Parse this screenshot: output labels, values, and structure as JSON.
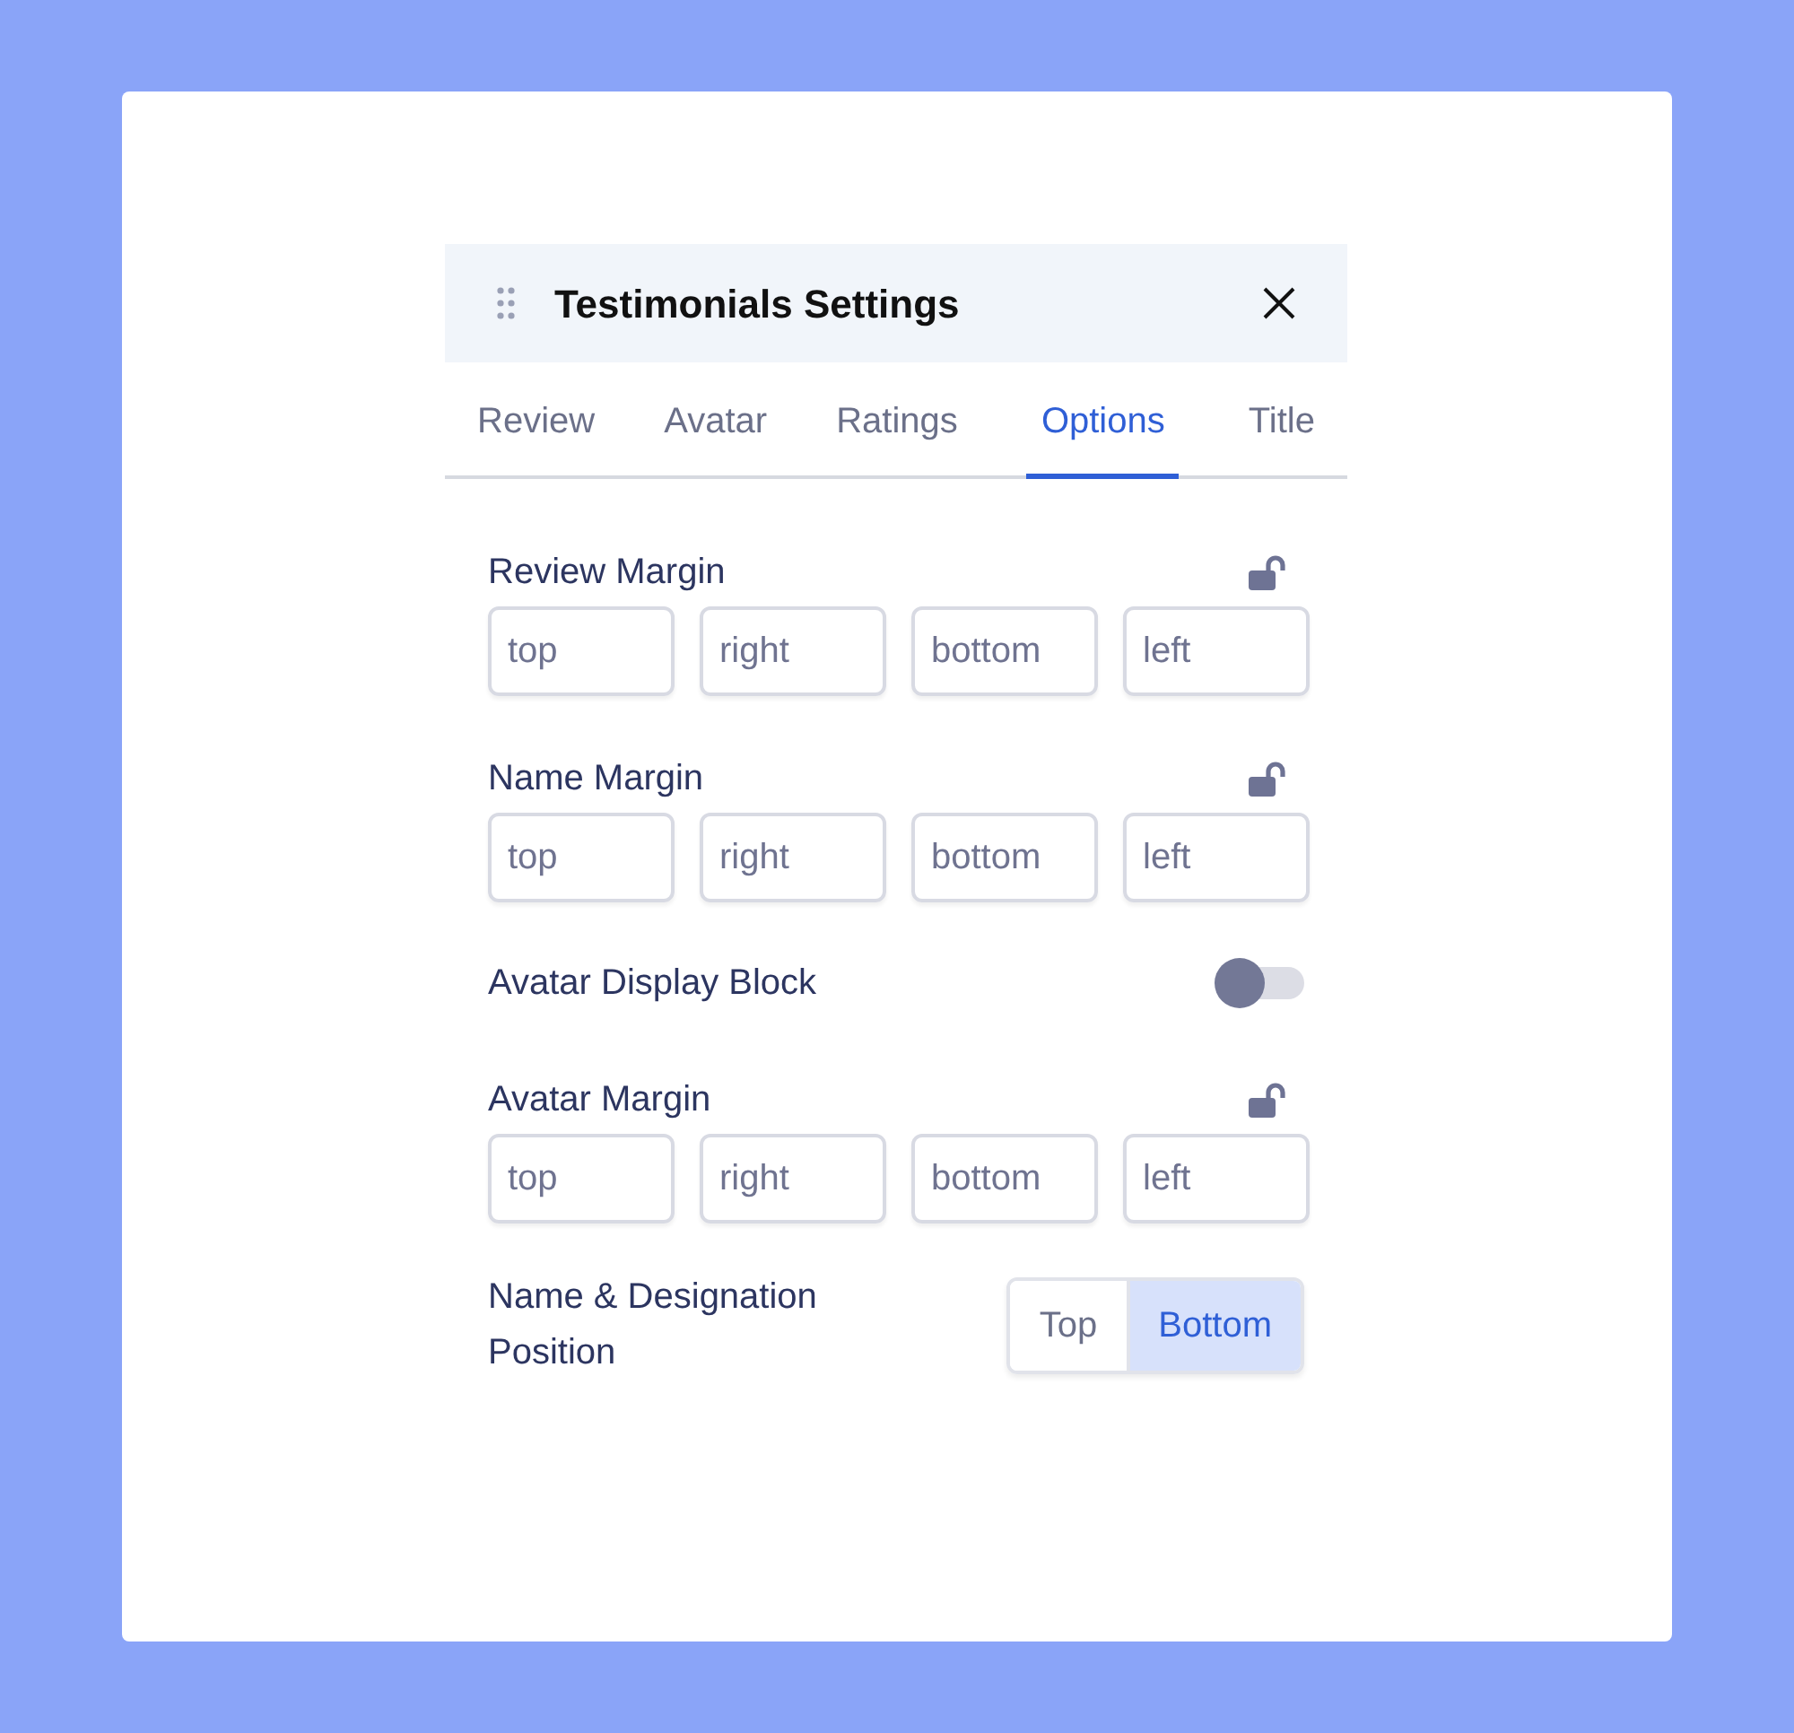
{
  "panel": {
    "title": "Testimonials Settings"
  },
  "tabs": [
    {
      "label": "Review",
      "selected": false
    },
    {
      "label": "Avatar",
      "selected": false
    },
    {
      "label": "Ratings",
      "selected": false
    },
    {
      "label": "Options",
      "selected": true
    },
    {
      "label": "Title",
      "selected": false
    }
  ],
  "settings": [
    {
      "kind": "margin",
      "label": "Review Margin",
      "locked": false,
      "fields": [
        {
          "placeholder": "top"
        },
        {
          "placeholder": "right"
        },
        {
          "placeholder": "bottom"
        },
        {
          "placeholder": "left"
        }
      ]
    },
    {
      "kind": "margin",
      "label": "Name Margin",
      "locked": false,
      "fields": [
        {
          "placeholder": "top"
        },
        {
          "placeholder": "right"
        },
        {
          "placeholder": "bottom"
        },
        {
          "placeholder": "left"
        }
      ]
    },
    {
      "kind": "toggle",
      "label": "Avatar Display Block",
      "on": false
    },
    {
      "kind": "margin",
      "label": "Avatar Margin",
      "locked": false,
      "fields": [
        {
          "placeholder": "top"
        },
        {
          "placeholder": "right"
        },
        {
          "placeholder": "bottom"
        },
        {
          "placeholder": "left"
        }
      ]
    },
    {
      "kind": "segmented",
      "label": "Name & Designation Position",
      "options": [
        {
          "label": "Top",
          "selected": false
        },
        {
          "label": "Bottom",
          "selected": true
        }
      ]
    }
  ]
}
